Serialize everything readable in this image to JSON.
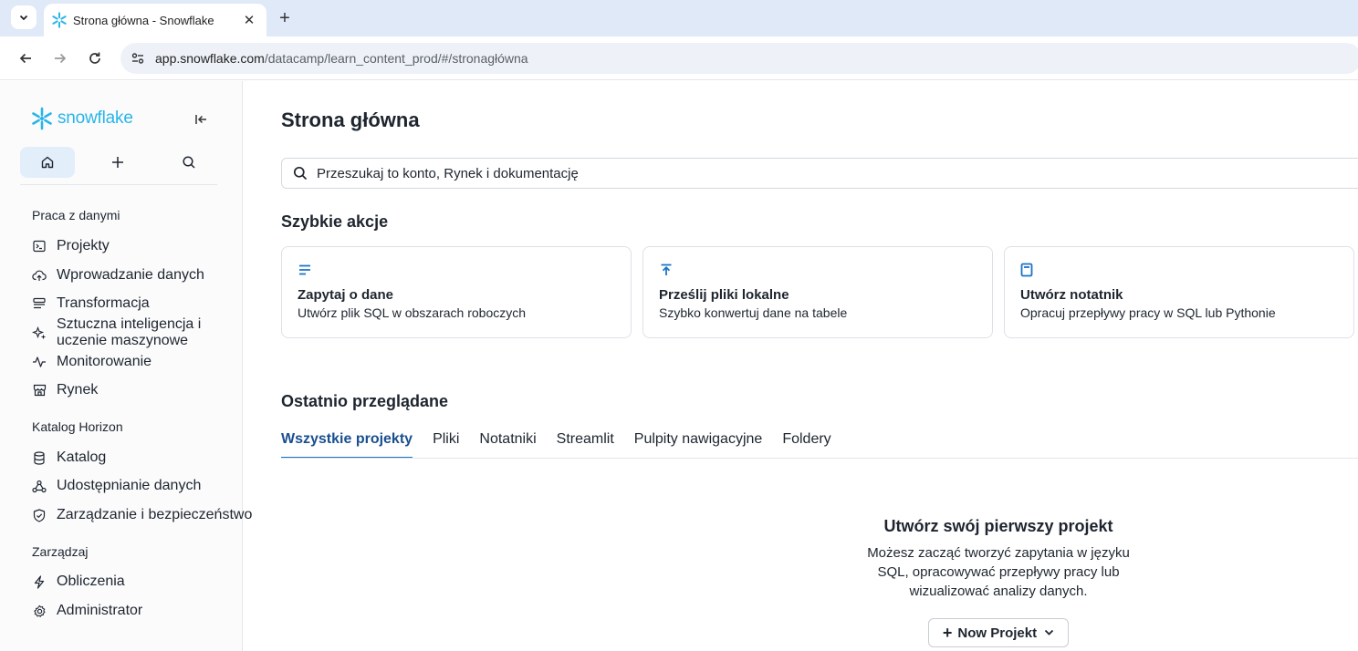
{
  "browser": {
    "tab_title": "Strona główna - Snowflake",
    "url_host": "app.snowflake.com",
    "url_path": "/datacamp/learn_content_prod/#/stronagłówna"
  },
  "sidebar": {
    "logo_text": "snowflake",
    "sections": {
      "work_with_data": "Praca z danymi",
      "horizon_catalog": "Katalog Horizon",
      "manage": "Zarządzaj"
    },
    "items": {
      "projects": "Projekty",
      "data_ingestion": "Wprowadzanie danych",
      "transformation": "Transformacja",
      "ai_ml": "Sztuczna inteligencja i uczenie maszynowe",
      "monitoring": "Monitorowanie",
      "marketplace": "Rynek",
      "catalog": "Katalog",
      "data_sharing": "Udostępnianie danych",
      "governance": "Zarządzanie i bezpieczeństwo",
      "compute": "Obliczenia",
      "admin": "Administrator"
    }
  },
  "main": {
    "title": "Strona główna",
    "search_placeholder": "Przeszukaj to konto, Rynek i dokumentację",
    "quick_actions_heading": "Szybkie akcje",
    "cards": [
      {
        "title": "Zapytaj o dane",
        "desc": "Utwórz plik SQL w obszarach roboczych"
      },
      {
        "title": "Prześlij pliki lokalne",
        "desc": "Szybko konwertuj dane na tabele"
      },
      {
        "title": "Utwórz notatnik",
        "desc": "Opracuj przepływy pracy w SQL lub Pythonie"
      }
    ],
    "recent_heading": "Ostatnio przeglądane",
    "tabs": [
      "Wszystkie projekty",
      "Pliki",
      "Notatniki",
      "Streamlit",
      "Pulpity nawigacyjne",
      "Foldery"
    ],
    "active_tab": "Wszystkie projekty",
    "empty_title": "Utwórz swój pierwszy projekt",
    "empty_desc": "Możesz zacząć tworzyć zapytania w języku SQL, opracowywać przepływy pracy lub wizualizować analizy danych.",
    "new_project_label": "Now Projekt"
  },
  "colors": {
    "brand": "#29b5e8",
    "accent": "#1a73c8",
    "active_tab_text": "#1a4f8f"
  }
}
